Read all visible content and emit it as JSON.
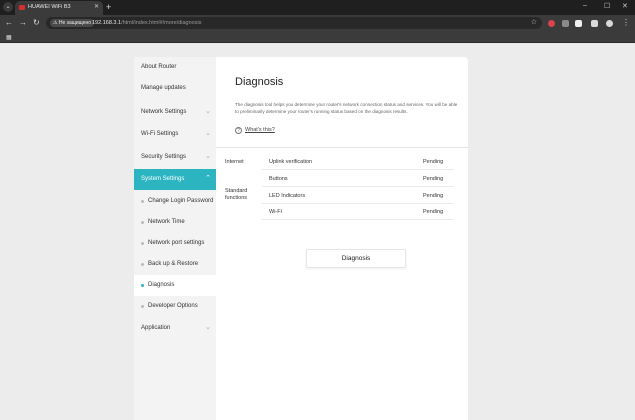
{
  "browser": {
    "tab_title": "HUAWEI WiFi B3",
    "tab_menu_icon": "chevron-down-icon",
    "security_label": "Не защищено",
    "url_host": "192.168.3.1",
    "url_path": "/html/index.html#/more/diagnosis"
  },
  "sidebar": {
    "items": [
      {
        "label": "About Router",
        "type": "top"
      },
      {
        "label": "Manage updates",
        "type": "top"
      },
      {
        "label": "Network Settings",
        "type": "top",
        "expandable": true
      },
      {
        "label": "Wi-Fi Settings",
        "type": "top",
        "expandable": true
      },
      {
        "label": "Security Settings",
        "type": "top",
        "expandable": true
      },
      {
        "label": "System Settings",
        "type": "top",
        "expandable": true,
        "state": "expanded"
      },
      {
        "label": "Change Login Password",
        "type": "sub"
      },
      {
        "label": "Network Time",
        "type": "sub"
      },
      {
        "label": "Network port settings",
        "type": "sub"
      },
      {
        "label": "Back up & Restore",
        "type": "sub"
      },
      {
        "label": "Diagnosis",
        "type": "sub",
        "state": "selected"
      },
      {
        "label": "Developer Options",
        "type": "sub"
      },
      {
        "label": "Application",
        "type": "top",
        "expandable": true
      }
    ]
  },
  "main": {
    "title": "Diagnosis",
    "description": "The diagnosis tool helps you determine your router's network connection status and services. You will be able to preliminarily determine your router's running status based on the diagnosis results.",
    "whats_this": "What's this?",
    "groups": [
      {
        "label": "Internet"
      },
      {
        "label": "Standard functions"
      }
    ],
    "checks": [
      {
        "name": "Uplink verification",
        "status": "Pending"
      },
      {
        "name": "Buttons",
        "status": "Pending"
      },
      {
        "name": "LED Indicators",
        "status": "Pending"
      },
      {
        "name": "Wi-Fi",
        "status": "Pending"
      }
    ],
    "diagnosis_button": "Diagnosis"
  },
  "colors": {
    "accent": "#2cb5c0",
    "favicon": "#d32f2f"
  }
}
